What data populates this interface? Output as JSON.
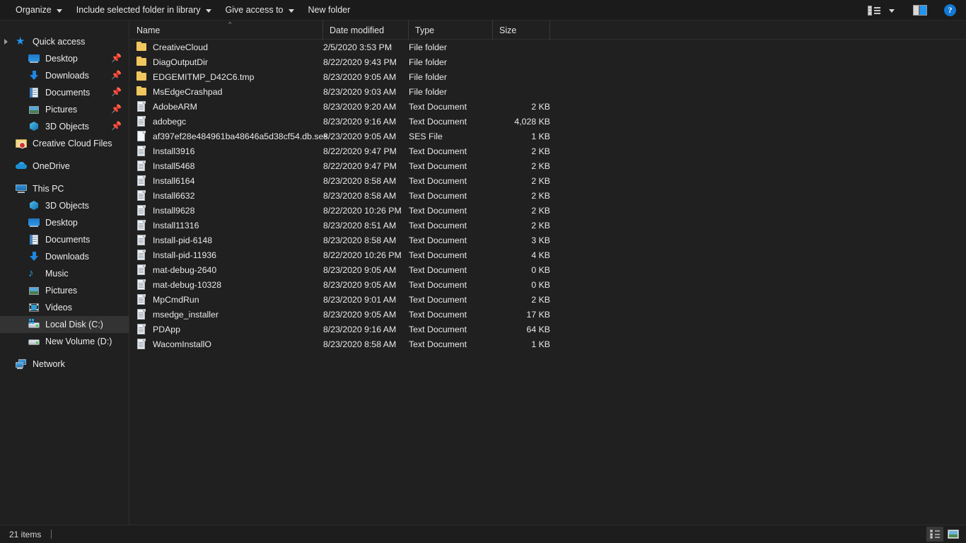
{
  "toolbar": {
    "items": [
      {
        "label": "Organize",
        "has_caret": true,
        "name": "organize"
      },
      {
        "label": "Include selected folder in library",
        "has_caret": true,
        "name": "include-in-library"
      },
      {
        "label": "Give access to",
        "has_caret": true,
        "name": "give-access-to"
      },
      {
        "label": "New folder",
        "has_caret": false,
        "name": "new-folder"
      }
    ],
    "right_icons": [
      {
        "name": "view-options-icon",
        "glyph": "list-view"
      },
      {
        "name": "view-options-caret-icon",
        "glyph": "caret-down"
      },
      {
        "name": "preview-pane-icon",
        "glyph": "preview-pane"
      },
      {
        "name": "help-icon",
        "glyph": "?",
        "color": "#1178d4"
      }
    ]
  },
  "sidebar": {
    "items": [
      {
        "label": "Quick access",
        "icon": "star-icon",
        "level": 0,
        "expandable": true,
        "pinned": false,
        "selected": false
      },
      {
        "label": "Desktop",
        "icon": "desktop-icon",
        "level": 1,
        "expandable": false,
        "pinned": true,
        "selected": false
      },
      {
        "label": "Downloads",
        "icon": "downloads-icon",
        "level": 1,
        "expandable": false,
        "pinned": true,
        "selected": false
      },
      {
        "label": "Documents",
        "icon": "documents-icon",
        "level": 1,
        "expandable": false,
        "pinned": true,
        "selected": false
      },
      {
        "label": "Pictures",
        "icon": "pictures-icon",
        "level": 1,
        "expandable": false,
        "pinned": true,
        "selected": false
      },
      {
        "label": "3D Objects",
        "icon": "3d-objects-icon",
        "level": 1,
        "expandable": false,
        "pinned": true,
        "selected": false
      },
      {
        "label": "Creative Cloud Files",
        "icon": "creative-cloud-icon",
        "level": 0,
        "expandable": false,
        "pinned": false,
        "selected": false
      },
      {
        "label": "OneDrive",
        "icon": "onedrive-cloud-icon",
        "level": 0,
        "expandable": false,
        "pinned": false,
        "selected": false
      },
      {
        "label": "This PC",
        "icon": "this-pc-icon",
        "level": 0,
        "expandable": false,
        "pinned": false,
        "selected": false
      },
      {
        "label": "3D Objects",
        "icon": "3d-objects-icon",
        "level": 1,
        "expandable": false,
        "pinned": false,
        "selected": false
      },
      {
        "label": "Desktop",
        "icon": "desktop-icon",
        "level": 1,
        "expandable": false,
        "pinned": false,
        "selected": false
      },
      {
        "label": "Documents",
        "icon": "documents-icon",
        "level": 1,
        "expandable": false,
        "pinned": false,
        "selected": false
      },
      {
        "label": "Downloads",
        "icon": "downloads-icon",
        "level": 1,
        "expandable": false,
        "pinned": false,
        "selected": false
      },
      {
        "label": "Music",
        "icon": "music-icon",
        "level": 1,
        "expandable": false,
        "pinned": false,
        "selected": false
      },
      {
        "label": "Pictures",
        "icon": "pictures-icon",
        "level": 1,
        "expandable": false,
        "pinned": false,
        "selected": false
      },
      {
        "label": "Videos",
        "icon": "videos-icon",
        "level": 1,
        "expandable": false,
        "pinned": false,
        "selected": false
      },
      {
        "label": "Local Disk (C:)",
        "icon": "local-disk-icon",
        "level": 1,
        "expandable": false,
        "pinned": false,
        "selected": true
      },
      {
        "label": "New Volume (D:)",
        "icon": "drive-icon",
        "level": 1,
        "expandable": false,
        "pinned": false,
        "selected": false
      },
      {
        "label": "Network",
        "icon": "network-icon",
        "level": 0,
        "expandable": false,
        "pinned": false,
        "selected": false
      }
    ]
  },
  "file_list": {
    "columns": [
      {
        "label": "Name",
        "name": "column-name"
      },
      {
        "label": "Date modified",
        "name": "column-date-modified"
      },
      {
        "label": "Type",
        "name": "column-type"
      },
      {
        "label": "Size",
        "name": "column-size"
      }
    ],
    "sort": {
      "column": "Name",
      "direction": "ascending",
      "indicator": "^"
    },
    "rows": [
      {
        "name": "CreativeCloud",
        "date": "2/5/2020 3:53 PM",
        "type": "File folder",
        "size": "",
        "icon": "folder-icon"
      },
      {
        "name": "DiagOutputDir",
        "date": "8/22/2020 9:43 PM",
        "type": "File folder",
        "size": "",
        "icon": "folder-icon"
      },
      {
        "name": "EDGEMITMP_D42C6.tmp",
        "date": "8/23/2020 9:05 AM",
        "type": "File folder",
        "size": "",
        "icon": "folder-icon"
      },
      {
        "name": "MsEdgeCrashpad",
        "date": "8/23/2020 9:03 AM",
        "type": "File folder",
        "size": "",
        "icon": "folder-icon"
      },
      {
        "name": "AdobeARM",
        "date": "8/23/2020 9:20 AM",
        "type": "Text Document",
        "size": "2 KB",
        "icon": "text-document-icon"
      },
      {
        "name": "adobegc",
        "date": "8/23/2020 9:16 AM",
        "type": "Text Document",
        "size": "4,028 KB",
        "icon": "text-document-icon"
      },
      {
        "name": "af397ef28e484961ba48646a5d38cf54.db.ses",
        "date": "8/23/2020 9:05 AM",
        "type": "SES File",
        "size": "1 KB",
        "icon": "generic-file-icon"
      },
      {
        "name": "Install3916",
        "date": "8/22/2020 9:47 PM",
        "type": "Text Document",
        "size": "2 KB",
        "icon": "text-document-icon"
      },
      {
        "name": "Install5468",
        "date": "8/22/2020 9:47 PM",
        "type": "Text Document",
        "size": "2 KB",
        "icon": "text-document-icon"
      },
      {
        "name": "Install6164",
        "date": "8/23/2020 8:58 AM",
        "type": "Text Document",
        "size": "2 KB",
        "icon": "text-document-icon"
      },
      {
        "name": "Install6632",
        "date": "8/23/2020 8:58 AM",
        "type": "Text Document",
        "size": "2 KB",
        "icon": "text-document-icon"
      },
      {
        "name": "Install9628",
        "date": "8/22/2020 10:26 PM",
        "type": "Text Document",
        "size": "2 KB",
        "icon": "text-document-icon"
      },
      {
        "name": "Install11316",
        "date": "8/23/2020 8:51 AM",
        "type": "Text Document",
        "size": "2 KB",
        "icon": "text-document-icon"
      },
      {
        "name": "Install-pid-6148",
        "date": "8/23/2020 8:58 AM",
        "type": "Text Document",
        "size": "3 KB",
        "icon": "text-document-icon"
      },
      {
        "name": "Install-pid-11936",
        "date": "8/22/2020 10:26 PM",
        "type": "Text Document",
        "size": "4 KB",
        "icon": "text-document-icon"
      },
      {
        "name": "mat-debug-2640",
        "date": "8/23/2020 9:05 AM",
        "type": "Text Document",
        "size": "0 KB",
        "icon": "text-document-icon"
      },
      {
        "name": "mat-debug-10328",
        "date": "8/23/2020 9:05 AM",
        "type": "Text Document",
        "size": "0 KB",
        "icon": "text-document-icon"
      },
      {
        "name": "MpCmdRun",
        "date": "8/23/2020 9:01 AM",
        "type": "Text Document",
        "size": "2 KB",
        "icon": "text-document-icon"
      },
      {
        "name": "msedge_installer",
        "date": "8/23/2020 9:05 AM",
        "type": "Text Document",
        "size": "17 KB",
        "icon": "text-document-icon"
      },
      {
        "name": "PDApp",
        "date": "8/23/2020 9:16 AM",
        "type": "Text Document",
        "size": "64 KB",
        "icon": "text-document-icon"
      },
      {
        "name": "WacomInstallO",
        "date": "8/23/2020 8:58 AM",
        "type": "Text Document",
        "size": "1 KB",
        "icon": "text-document-icon"
      }
    ]
  },
  "status_bar": {
    "item_count": "21 items",
    "views": [
      {
        "name": "details-view-button",
        "active": true
      },
      {
        "name": "large-icons-view-button",
        "active": false
      }
    ]
  },
  "colors": {
    "background": "#202020",
    "toolbar": "#1b1b1b",
    "selection": "#333333",
    "accent": "#1178d4",
    "folder": "#f0c75e"
  }
}
